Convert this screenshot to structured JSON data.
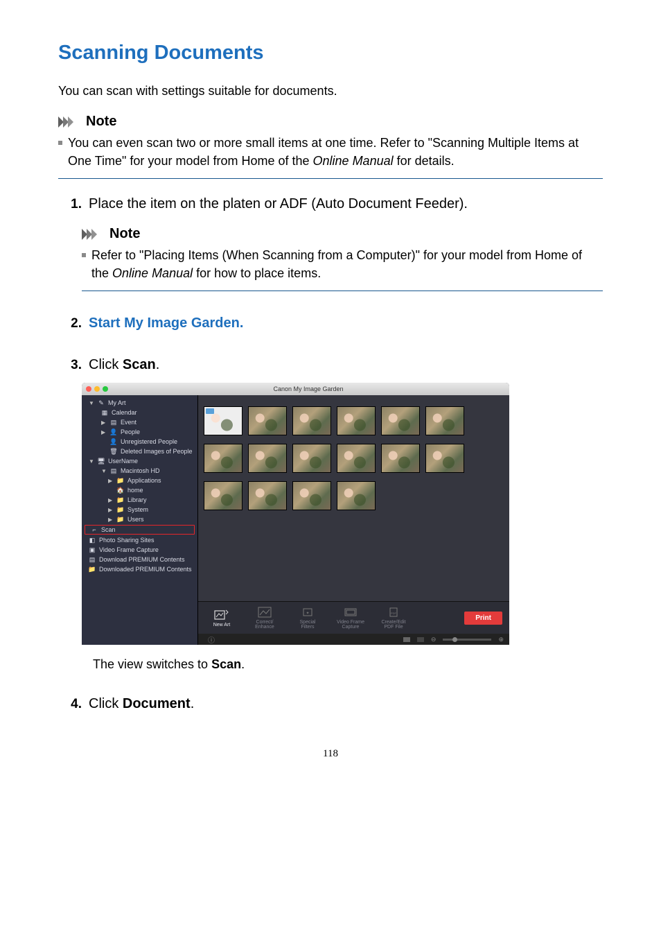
{
  "page": {
    "title": "Scanning Documents",
    "intro": "You can scan with settings suitable for documents.",
    "page_number": "118"
  },
  "note1": {
    "heading": "Note",
    "body_pre": "You can even scan two or more small items at one time. Refer to \"Scanning Multiple Items at One Time\" for your model from Home of the ",
    "body_em": "Online Manual",
    "body_post": " for details."
  },
  "steps": {
    "s1": {
      "num": "1.",
      "text": "Place the item on the platen or ADF (Auto Document Feeder)."
    },
    "s2": {
      "num": "2.",
      "link": "Start My Image Garden."
    },
    "s3": {
      "num": "3.",
      "pre": "Click ",
      "bold": "Scan",
      "post": ".",
      "result_pre": "The view switches to ",
      "result_bold": "Scan",
      "result_post": "."
    },
    "s4": {
      "num": "4.",
      "pre": "Click ",
      "bold": "Document",
      "post": "."
    }
  },
  "sub_note": {
    "heading": "Note",
    "body_pre": "Refer to \"Placing Items (When Scanning from a Computer)\" for your model from Home of the ",
    "body_em": "Online Manual",
    "body_post": " for how to place items."
  },
  "app": {
    "title": "Canon My Image Garden",
    "sidebar": {
      "my_art": "My Art",
      "calendar": "Calendar",
      "event": "Event",
      "people": "People",
      "unregistered": "Unregistered People",
      "deleted": "Deleted Images of People",
      "username": "UserName",
      "mac_hd": "Macintosh HD",
      "applications": "Applications",
      "home": "home",
      "library": "Library",
      "system": "System",
      "users": "Users",
      "scan": "Scan",
      "photo_sharing": "Photo Sharing Sites",
      "video_frame": "Video Frame Capture",
      "download_premium": "Download PREMIUM Contents",
      "downloaded_premium": "Downloaded PREMIUM Contents"
    },
    "bottom": {
      "new_art": "New Art",
      "correct": "Correct/\nEnhance",
      "filters": "Special\nFilters",
      "capture": "Video Frame\nCapture",
      "pdf": "Create/Edit\nPDF File",
      "print": "Print"
    }
  }
}
